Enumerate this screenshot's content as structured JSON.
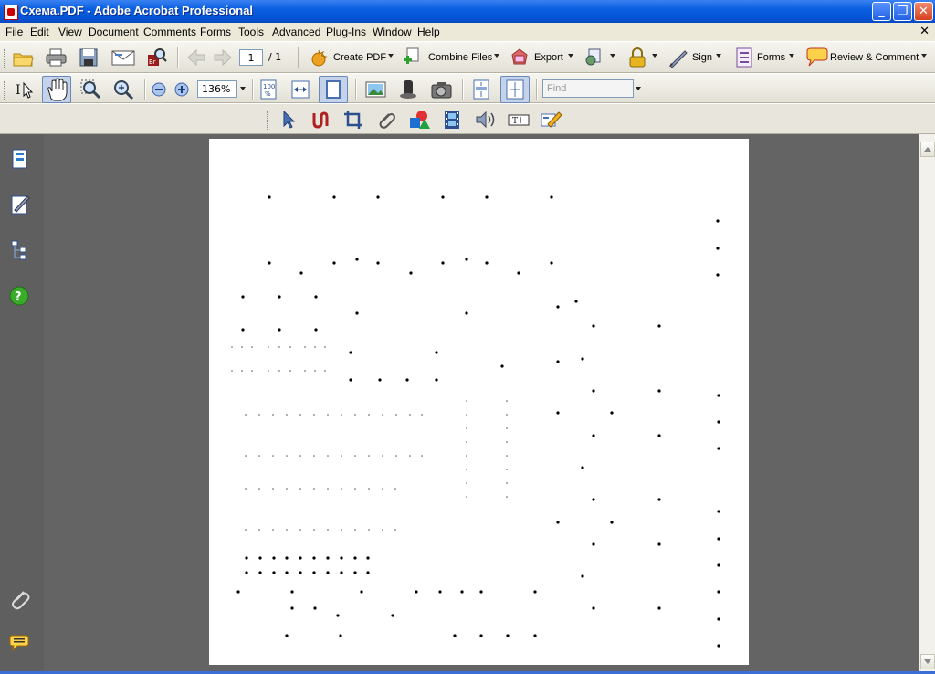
{
  "window": {
    "title": "Схема.PDF - Adobe Acrobat Professional"
  },
  "menu": [
    "File",
    "Edit",
    "View",
    "Document",
    "Comments",
    "Forms",
    "Tools",
    "Advanced",
    "Plug-Ins",
    "Window",
    "Help"
  ],
  "toolbar": {
    "page_current": "1",
    "page_total": "/ 1",
    "create_pdf": "Create PDF",
    "combine_files": "Combine Files",
    "export": "Export",
    "sign": "Sign",
    "forms": "Forms",
    "review_comment": "Review & Comment",
    "zoom": "136%",
    "find_placeholder": "Find"
  },
  "colors": {
    "title_bar": "#0a5fe0",
    "document_bg": "#646464",
    "sidebar_bg": "#5f5f5f"
  },
  "icons": {
    "toolbar1": [
      "open-icon",
      "print-icon",
      "save-icon",
      "email-icon",
      "search-document-icon",
      "previous-page-icon",
      "next-page-icon",
      "create-pdf-icon",
      "combine-files-icon",
      "export-icon",
      "secure-icon",
      "lock-icon",
      "sign-icon",
      "forms-icon",
      "review-comment-icon"
    ],
    "toolbar2": [
      "select-tool-icon",
      "hand-tool-icon",
      "marquee-zoom-icon",
      "dynamic-zoom-icon",
      "zoom-out-icon",
      "zoom-in-icon",
      "actual-size-icon",
      "fit-width-icon",
      "fit-page-icon",
      "take-snapshot-icon",
      "document-properties-icon",
      "camera-icon",
      "single-page-icon",
      "full-screen-icon"
    ],
    "toolbar3": [
      "pointer-icon",
      "link-tool-icon",
      "crop-tool-icon",
      "attach-icon",
      "shape-tool-icon",
      "movie-icon",
      "sound-icon",
      "text-field-icon",
      "edit-text-icon"
    ],
    "sidebar": [
      "pages-icon",
      "signatures-icon",
      "layers-icon",
      "help-icon",
      "attachments-icon",
      "comments-icon"
    ]
  }
}
